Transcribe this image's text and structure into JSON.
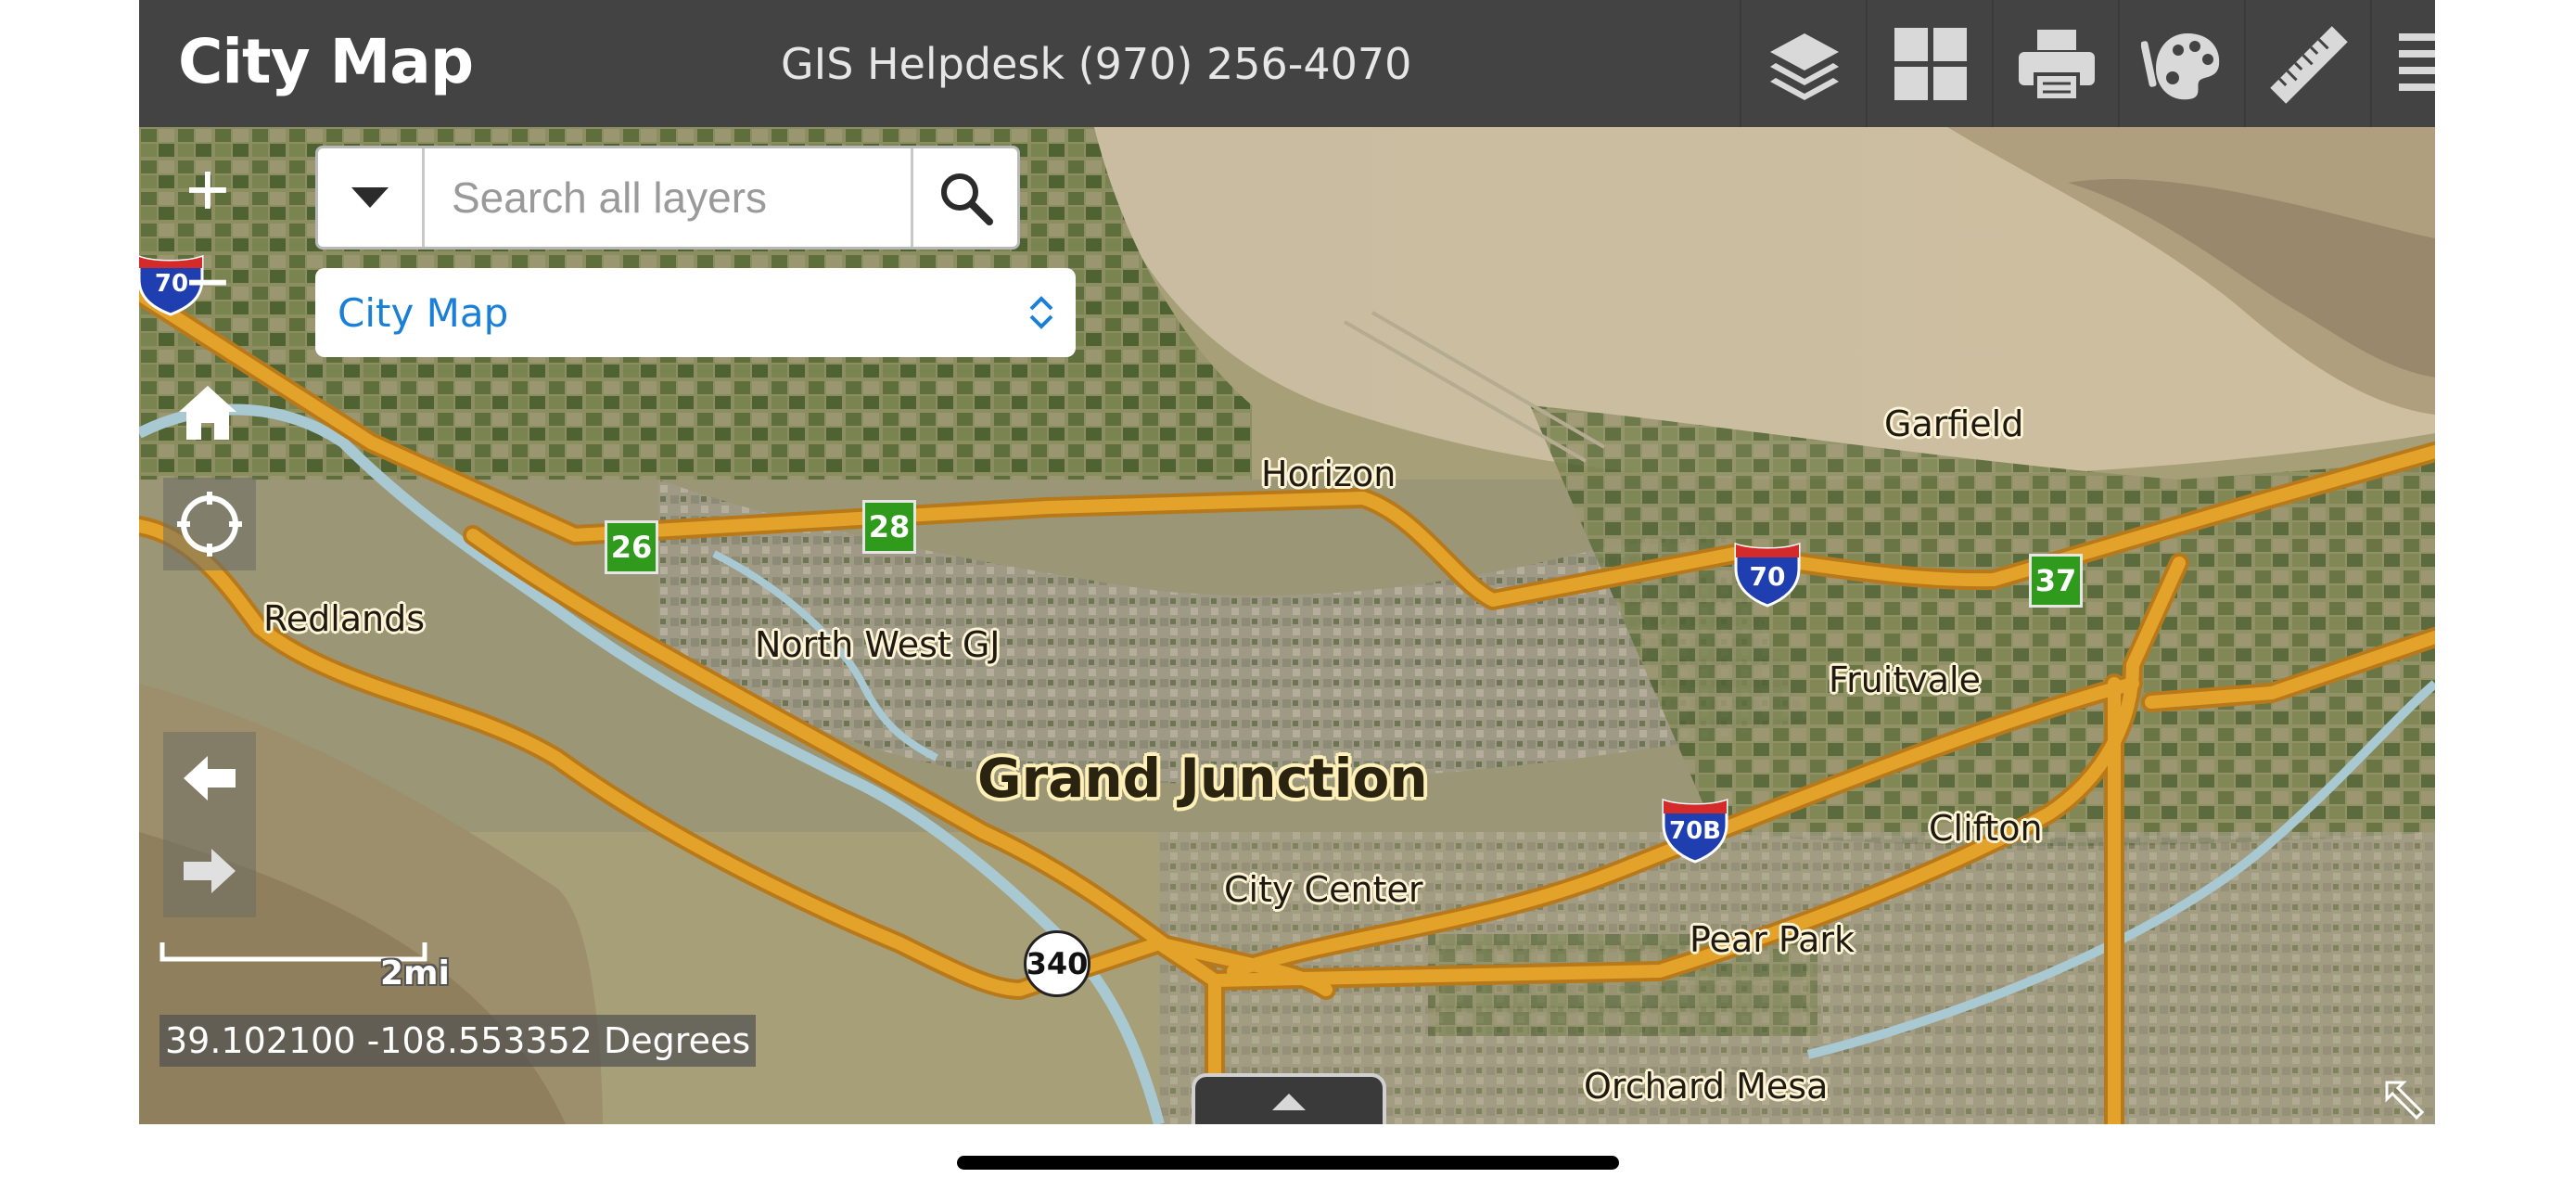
{
  "header": {
    "title": "City Map",
    "helpdesk": "GIS Helpdesk (970) 256-4070",
    "bg_color": "#434343",
    "tools": [
      {
        "name": "layers-icon"
      },
      {
        "name": "basemap-gallery-icon"
      },
      {
        "name": "print-icon"
      },
      {
        "name": "draw-palette-icon"
      },
      {
        "name": "measure-ruler-icon"
      },
      {
        "name": "legend-list-icon"
      }
    ]
  },
  "search": {
    "placeholder": "Search all layers",
    "dropdown_icon": "chevron-down-icon",
    "submit_icon": "search-icon"
  },
  "map_selector": {
    "selected": "City Map",
    "accent": "#1a7fd6"
  },
  "map_controls": {
    "zoom_in": "+",
    "zoom_out": "−",
    "home_icon": "home-icon",
    "locate_icon": "locate-icon",
    "back_icon": "arrow-left-icon",
    "forward_icon": "arrow-right-icon"
  },
  "places": {
    "grand_junction": "Grand Junction",
    "horizon": "Horizon",
    "garfield": "Garfield",
    "redlands": "Redlands",
    "north_west_gj": "North West GJ",
    "fruitvale": "Fruitvale",
    "clifton": "Clifton",
    "city_center": "City Center",
    "pear_park": "Pear Park",
    "orchard_mesa": "Orchard Mesa"
  },
  "route_shields": {
    "i70_west": "70",
    "i70_east": "70",
    "i70b": "70B",
    "exit_26": "26",
    "exit_28": "28",
    "exit_37": "37",
    "sh_340": "340"
  },
  "scale": {
    "label": "2mi"
  },
  "coordinates": "39.102100 -108.553352 Degrees",
  "colors": {
    "road": "#e3a32a",
    "road_edge": "#b8791a",
    "river": "#a8c8d2",
    "interstate_red": "#d42a2a",
    "interstate_blue": "#1f3fb0",
    "exit_green": "#2f9a1c"
  }
}
